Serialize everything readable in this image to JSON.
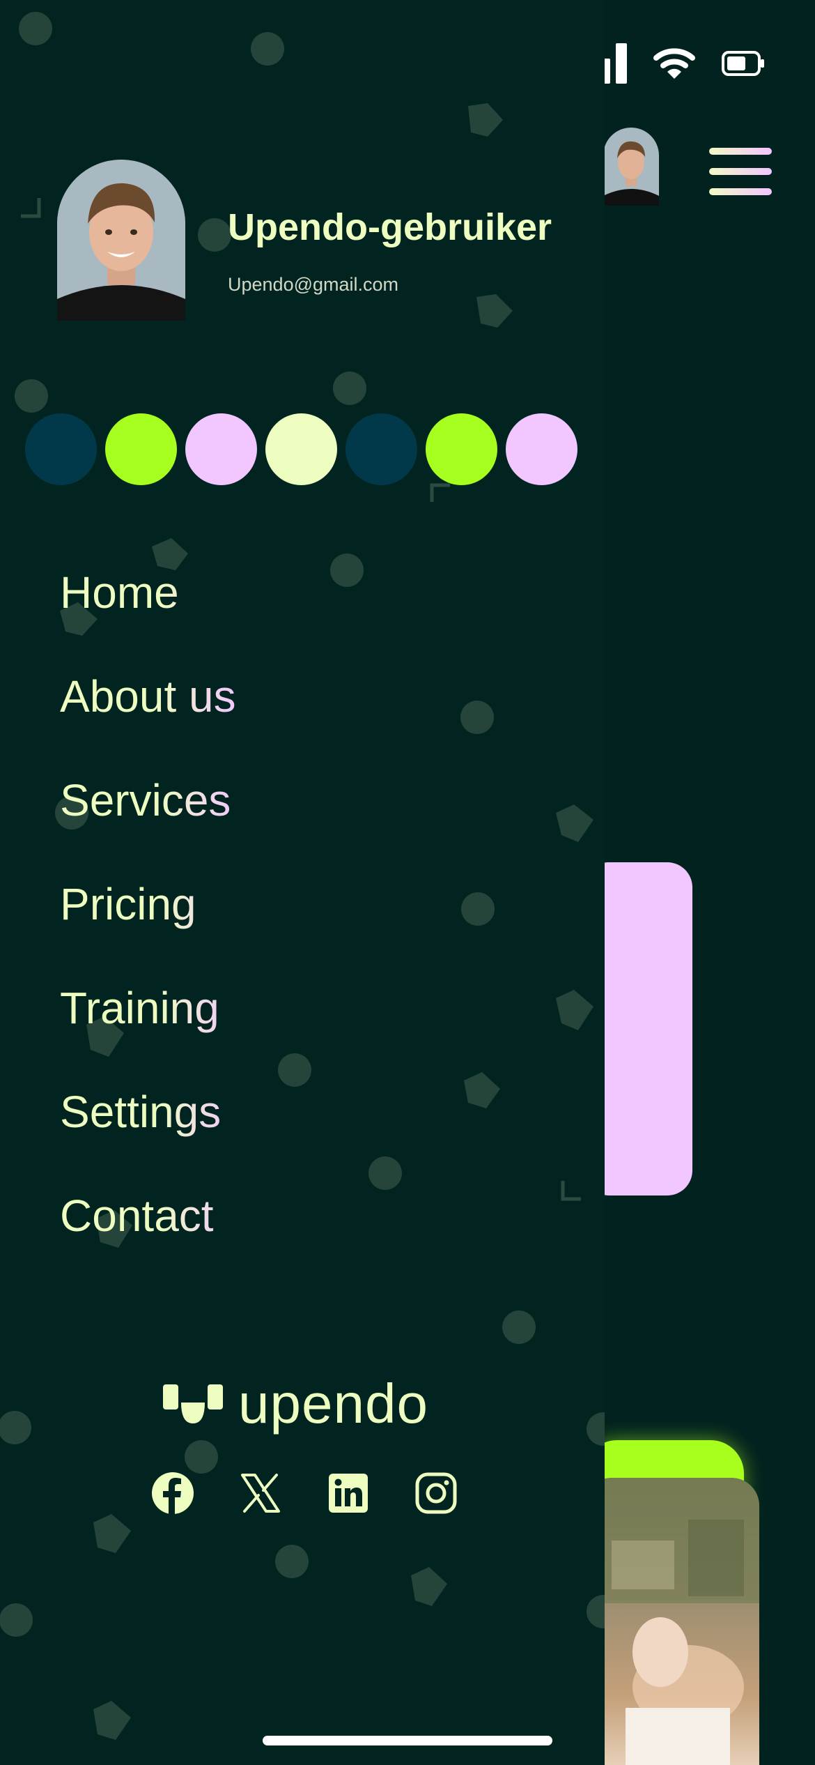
{
  "profile": {
    "name": "Upendo-gebruiker",
    "email": "Upendo@gmail.com"
  },
  "color_dots": [
    "#02394a",
    "#a6ff1e",
    "#f2c6ff",
    "#eefec0",
    "#02394a",
    "#a6ff1e",
    "#f2c6ff"
  ],
  "menu": {
    "items": [
      {
        "label": "Home"
      },
      {
        "label": "About us"
      },
      {
        "label": "Services"
      },
      {
        "label": "Pricing"
      },
      {
        "label": "Training"
      },
      {
        "label": "Settings"
      },
      {
        "label": "Contact"
      }
    ]
  },
  "brand": {
    "name": "upendo"
  },
  "socials": [
    "facebook-icon",
    "x-icon",
    "linkedin-icon",
    "instagram-icon"
  ],
  "colors": {
    "background": "#02221f",
    "text_cream": "#eefec0",
    "pink": "#f2c7ff",
    "lime": "#a8ff1d"
  }
}
